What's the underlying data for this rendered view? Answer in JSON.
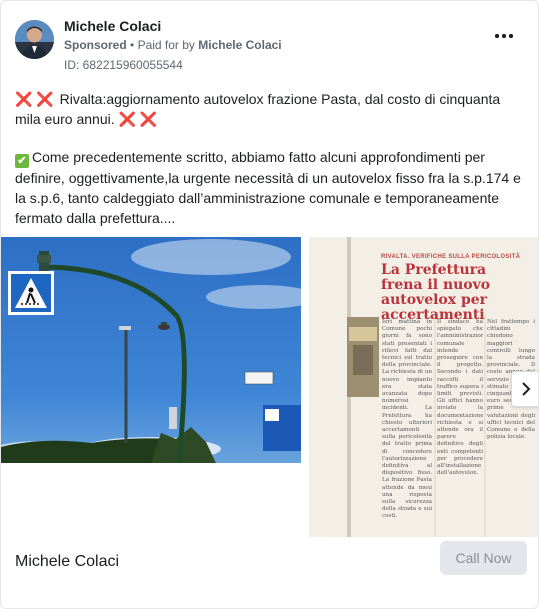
{
  "post": {
    "author": "Michele Colaci",
    "sponsored_label": "Sponsored",
    "paid_for_prefix": "Paid for by",
    "paid_for_name": "Michele Colaci",
    "ad_id": "ID: 682215960055544",
    "more_icon": "more-horizontal-icon",
    "line1_icons": "❌ ❌",
    "line1_text": "Rivalta:aggiornamento autovelox frazione Pasta, dal costo di cinquanta mila euro annui.",
    "line1_end_icons": "❌ ❌",
    "check_icon": "✔",
    "line2_text": "Come precedentemente scritto, abbiamo fatto alcuni approfondimenti per definire, oggettivamente,la urgente necessità di un autovelox fisso fra la s.p.174 e la s.p.6, tanto caldeggiato dall’amministrazione comunale e temporaneamente fermato dalla prefettura...."
  },
  "carousel": {
    "slide2": {
      "kicker": "RIVALTA. VERIFICHE SULLA PERICOLOSITÀ",
      "headline": "La Prefettura frena il nuovo autovelox per accertamenti"
    },
    "next_icon": "chevron-right-icon"
  },
  "footer": {
    "title": "Michele Colaci",
    "cta_label": "Call Now"
  },
  "colors": {
    "cta_bg": "#e4e6eb",
    "headline_red": "#b8333a",
    "sky_blue": "#2f73c6"
  }
}
